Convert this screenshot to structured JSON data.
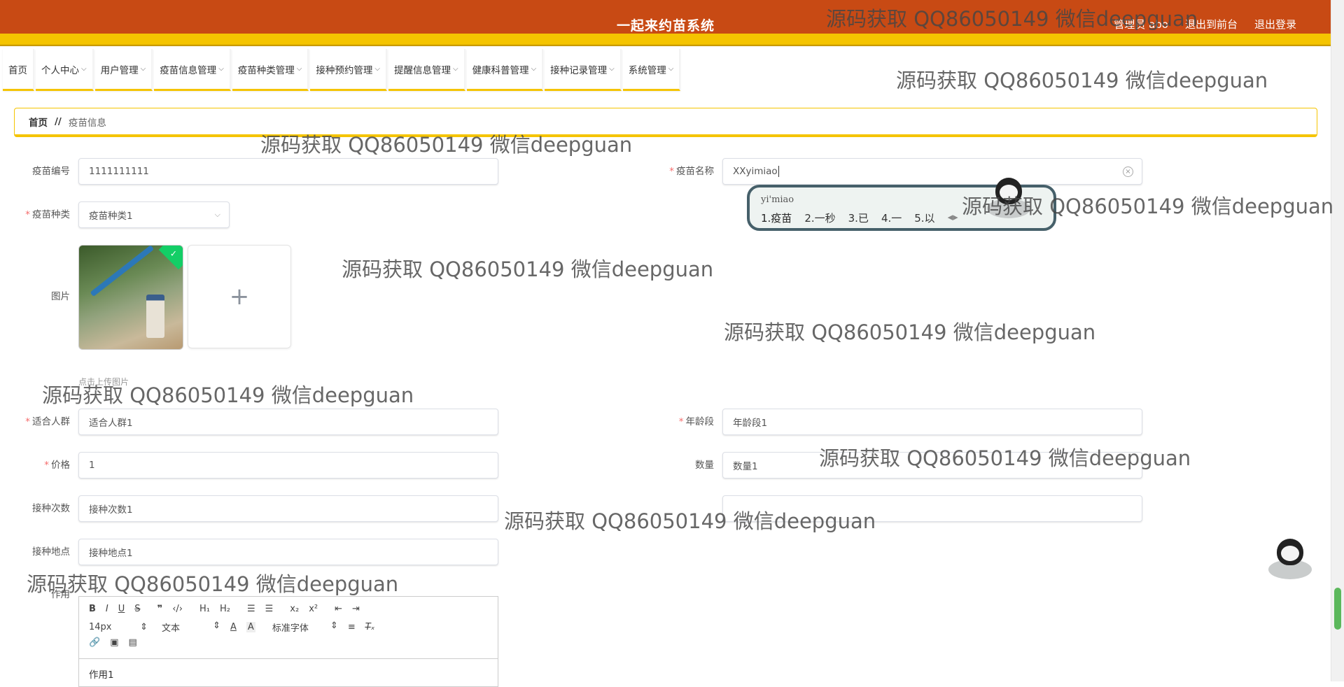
{
  "header": {
    "title": "一起来约苗系统",
    "user": "管理员 abo",
    "actions": [
      "退出到前台",
      "退出登录"
    ]
  },
  "nav": [
    "首页",
    "个人中心",
    "用户管理",
    "疫苗信息管理",
    "疫苗种类管理",
    "接种预约管理",
    "提醒信息管理",
    "健康科普管理",
    "接种记录管理",
    "系统管理"
  ],
  "breadcrumb": {
    "home": "首页",
    "sep": "//",
    "current": "疫苗信息"
  },
  "form": {
    "code_label": "疫苗编号",
    "code_value": "1111111111",
    "name_label": "疫苗名称",
    "name_value": "XXyimiao",
    "type_label": "疫苗种类",
    "type_value": "疫苗种类1",
    "image_label": "图片",
    "upload_tip": "点击上传图片",
    "crowd_label": "适合人群",
    "crowd_value": "适合人群1",
    "age_label": "年龄段",
    "age_value": "年龄段1",
    "price_label": "价格",
    "price_value": "1",
    "qty_label": "数量",
    "qty_value": "数量1",
    "times_label": "接种次数",
    "times_value": "接种次数1",
    "place_label": "接种地点",
    "place_value": "接种地点1",
    "effect_label": "作用"
  },
  "ime": {
    "pinyin": "yi'miao",
    "candidates": [
      "1.疫苗",
      "2.一秒",
      "3.已",
      "4.一",
      "5.以"
    ]
  },
  "editor": {
    "font_size": "14px",
    "block_type": "文本",
    "font_family": "标准字体",
    "content": "作用1"
  },
  "watermark": "源码获取 QQ86050149 微信deepguan",
  "colors": {
    "header": "#c84a14",
    "accent": "#f5c400",
    "required": "#f56c6c",
    "success": "#13ce66"
  }
}
